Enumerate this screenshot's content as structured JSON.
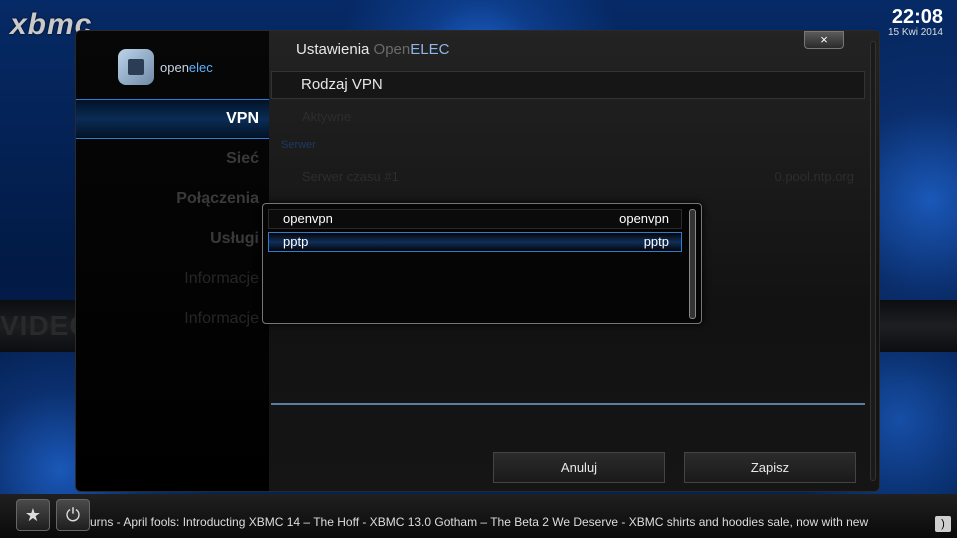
{
  "background": {
    "label": "VIDEO"
  },
  "xbmc": {
    "logo": "xbmc"
  },
  "clock": {
    "time": "22:08",
    "date": "15 Kwi 2014"
  },
  "dialog": {
    "title_main": "Ustawienia ",
    "title_open": "Open",
    "title_elec": "ELEC",
    "close_glyph": "×",
    "logo": {
      "prefix": "open",
      "suffix": "elec"
    },
    "sidebar": {
      "items": [
        {
          "label": "VPN",
          "active": true
        },
        {
          "label": "Sieć",
          "active": false
        },
        {
          "label": "Połączenia",
          "active": false
        },
        {
          "label": "Usługi",
          "active": false
        },
        {
          "label": "Informacje",
          "active": false
        },
        {
          "label": "Informacje",
          "active": false
        }
      ]
    },
    "header": {
      "label": "Rodzaj VPN"
    },
    "ghost": {
      "section1": "S",
      "item1": "Aktywne",
      "section2": "Serwer",
      "item2": "Serwer czasu #1",
      "item3_value": "0.pool.ntp.org"
    },
    "buttons": {
      "cancel": "Anuluj",
      "save": "Zapisz"
    }
  },
  "popup": {
    "options": [
      {
        "label": "openvpn",
        "value": "openvpn",
        "selected": false
      },
      {
        "label": "pptp",
        "value": "pptp",
        "selected": true
      }
    ]
  },
  "bottom": {
    "favourites_icon": "star-icon",
    "power_icon": "power-icon",
    "ticker": "urns - April fools: Introducting XBMC 14 – The Hoff - XBMC 13.0 Gotham – The Beta 2 We Deserve - XBMC shirts and hoodies sale, now with new",
    "rss_icon": "rss-icon"
  }
}
